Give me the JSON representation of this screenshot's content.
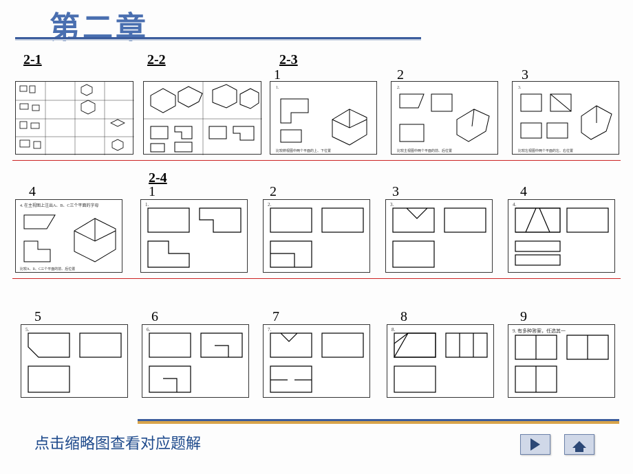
{
  "title": "第二章",
  "instruction": "点击缩略图查看对应题解",
  "links": {
    "s21": "2-1",
    "s22": "2-2",
    "s23": "2-3",
    "s24": "2-4"
  },
  "numbers": {
    "r1_1": "1",
    "r1_2": "2",
    "r1_3": "3",
    "r2_4": "4",
    "r2p_1": "1",
    "r2p_2": "2",
    "r2p_3": "3",
    "r2p_4": "4",
    "r3_5": "5",
    "r3_6": "6",
    "r3_7": "7",
    "r3_8": "8",
    "r3_9": "9"
  },
  "thumbnail_captions": {
    "p9": "9. 有多种答案，任选其一"
  }
}
